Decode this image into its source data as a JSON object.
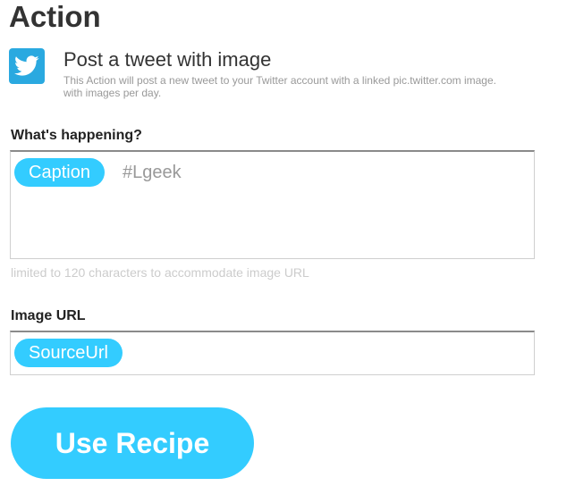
{
  "section": {
    "title": "Action"
  },
  "action": {
    "icon": "twitter-bird-icon",
    "name": "Post a tweet with image",
    "description_line1": "This Action will post a new tweet to your Twitter account with a linked pic.twitter.com image.",
    "description_line2": "with images per day."
  },
  "fields": {
    "whats_happening": {
      "label": "What's happening?",
      "ingredient": "Caption",
      "text": "#Lgeek",
      "hint": "limited to 120 characters to accommodate image URL"
    },
    "image_url": {
      "label": "Image URL",
      "ingredient": "SourceUrl"
    }
  },
  "button": {
    "label": "Use Recipe"
  },
  "colors": {
    "accent": "#33ccff",
    "twitter": "#2aa9e0",
    "text": "#333333",
    "muted": "#999999",
    "hint": "#cccccc"
  }
}
